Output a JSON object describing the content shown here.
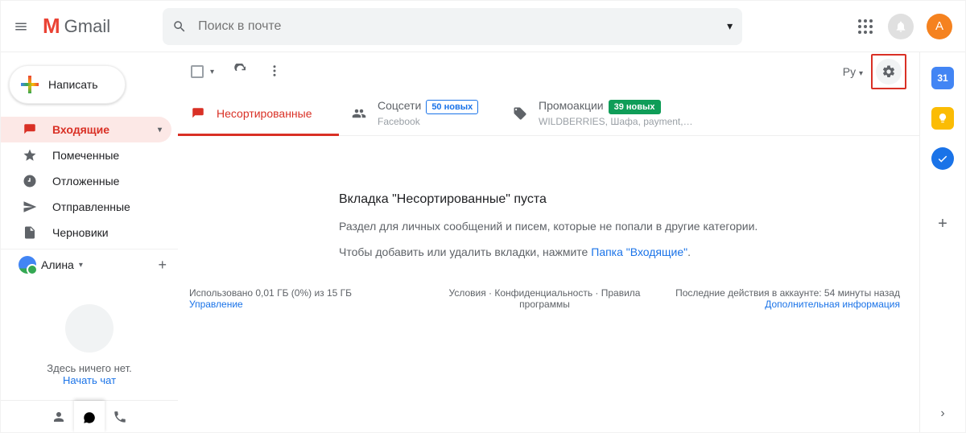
{
  "header": {
    "logo_text": "Gmail",
    "search_placeholder": "Поиск в почте",
    "avatar_letter": "А"
  },
  "sidebar": {
    "compose_label": "Написать",
    "items": [
      {
        "label": "Входящие"
      },
      {
        "label": "Помеченные"
      },
      {
        "label": "Отложенные"
      },
      {
        "label": "Отправленные"
      },
      {
        "label": "Черновики"
      }
    ],
    "user_name": "Алина",
    "hangouts_empty": "Здесь ничего нет.",
    "start_chat": "Начать чат"
  },
  "toolbar": {
    "lang_label": "Ру"
  },
  "tabs": {
    "primary": {
      "label": "Несортированные"
    },
    "social": {
      "label": "Соцсети",
      "badge": "50 новых",
      "sub": "Facebook"
    },
    "promo": {
      "label": "Промоакции",
      "badge": "39 новых",
      "sub": "WILDBERRIES, Шафа, payment,…"
    }
  },
  "empty": {
    "title": "Вкладка \"Несортированные\" пуста",
    "desc": "Раздел для личных сообщений и писем, которые не попали в другие категории.",
    "hint_prefix": "Чтобы добавить или удалить вкладки, нажмите ",
    "hint_link": "Папка \"Входящие\"",
    "hint_suffix": "."
  },
  "footer": {
    "storage_line1": "Использовано 0,01 ГБ (0%) из 15 ГБ",
    "storage_line2": "Управление",
    "center": "Условия · Конфиденциальность · Правила программы",
    "right_line1": "Последние действия в аккаунте: 54 минуты назад",
    "right_line2": "Дополнительная информация"
  }
}
